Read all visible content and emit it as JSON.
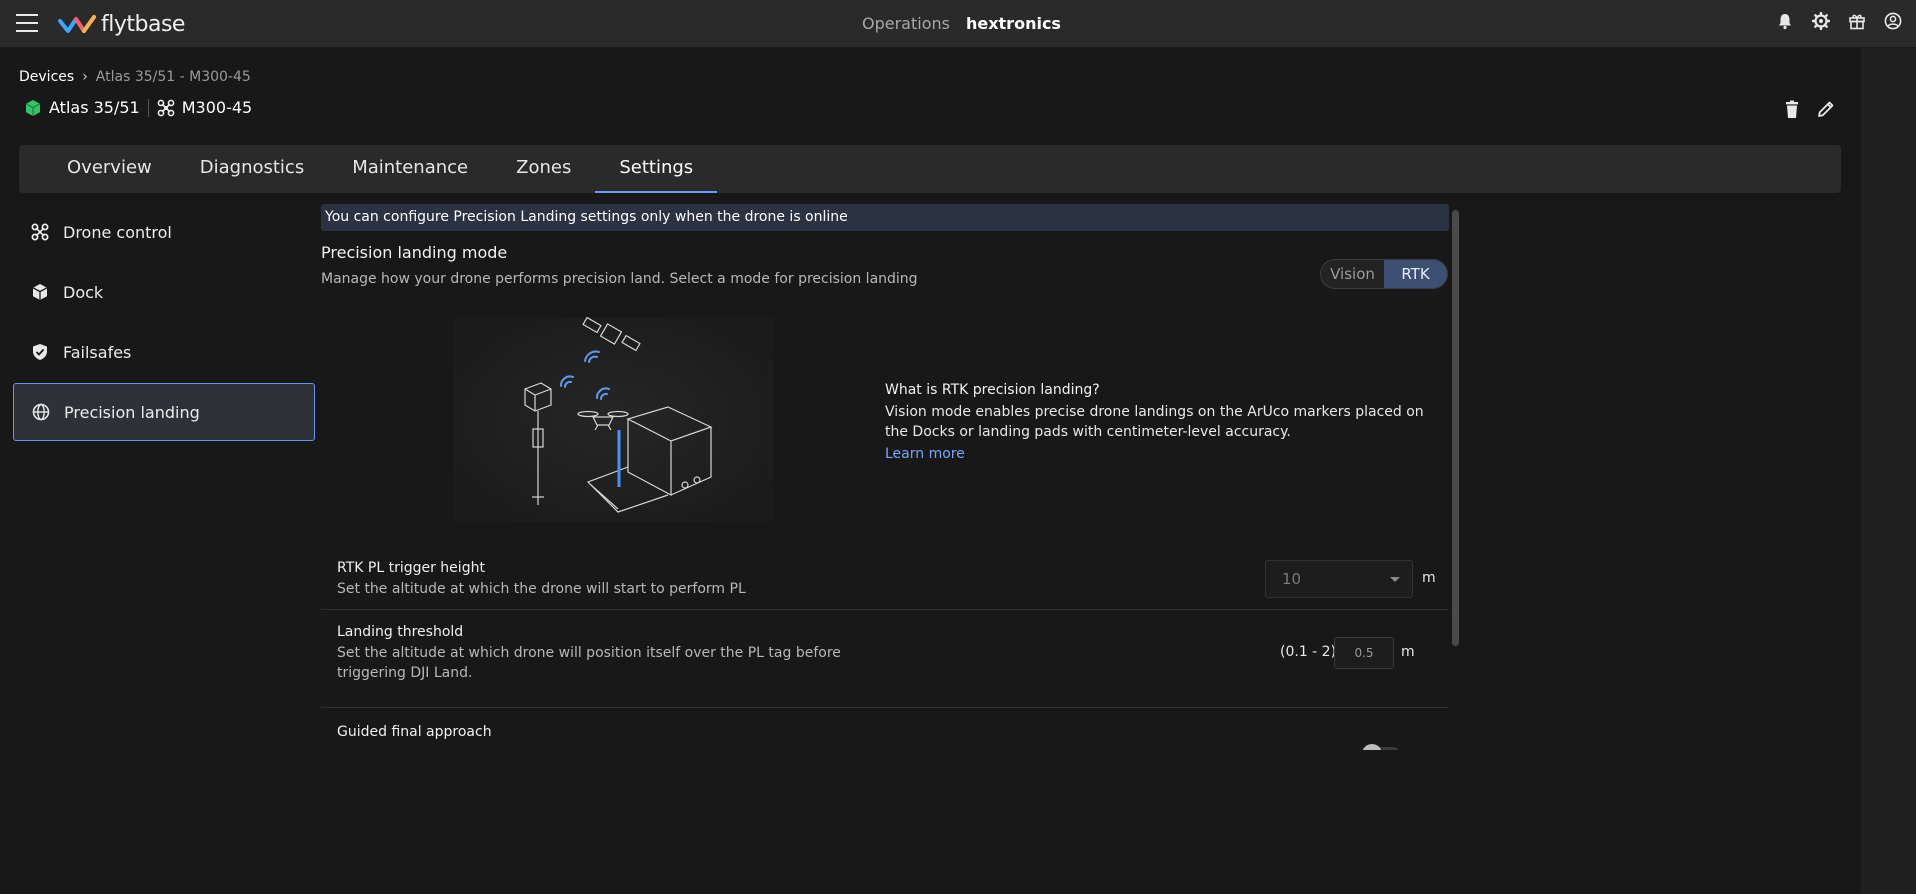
{
  "header": {
    "logo_text": "flytbase",
    "nav_operations": "Operations",
    "nav_org": "hextronics",
    "icons": [
      "bell-icon",
      "gear-icon",
      "gift-icon",
      "account-icon"
    ]
  },
  "breadcrumb": {
    "root": "Devices",
    "separator": "›",
    "current": "Atlas 35/51 - M300-45"
  },
  "device": {
    "dock_name": "Atlas 35/51",
    "drone_name": "M300-45",
    "dock_icon_color": "#35c46a"
  },
  "tabs": [
    {
      "label": "Overview"
    },
    {
      "label": "Diagnostics"
    },
    {
      "label": "Maintenance"
    },
    {
      "label": "Zones"
    },
    {
      "label": "Settings"
    }
  ],
  "active_tab": "Settings",
  "sidebar": {
    "items": [
      {
        "label": "Drone control",
        "icon": "drone-icon"
      },
      {
        "label": "Dock",
        "icon": "dock-icon"
      },
      {
        "label": "Failsafes",
        "icon": "shield-icon"
      },
      {
        "label": "Precision landing",
        "icon": "globe-icon"
      }
    ],
    "active": "Precision landing"
  },
  "main": {
    "banner": "You can configure Precision Landing settings only when the drone is online",
    "section_title": "Precision landing mode",
    "section_subtitle": "Manage how your drone performs precision land. Select a mode for precision landing",
    "mode_options": [
      "Vision",
      "RTK"
    ],
    "mode_selected": "RTK",
    "info": {
      "title": "What is RTK precision landing?",
      "body": "Vision mode enables precise drone landings on the ArUco markers placed on the Docks or landing pads with centimeter-level accuracy.",
      "link": "Learn more"
    },
    "settings": [
      {
        "title": "RTK PL trigger height",
        "description": "Set the altitude at which the drone will start to perform PL",
        "value": "10",
        "unit": "m"
      },
      {
        "title": "Landing threshold",
        "description": "Set the altitude at which drone will position itself over the PL tag before triggering DJI Land.",
        "range": "(0.1 - 2)",
        "value": "0.5",
        "unit": "m"
      },
      {
        "title": "Guided final approach",
        "toggle": false
      }
    ]
  },
  "colors": {
    "accent": "#6b9bff",
    "banner_bg": "#2b3241",
    "link": "#6fa8ff"
  }
}
